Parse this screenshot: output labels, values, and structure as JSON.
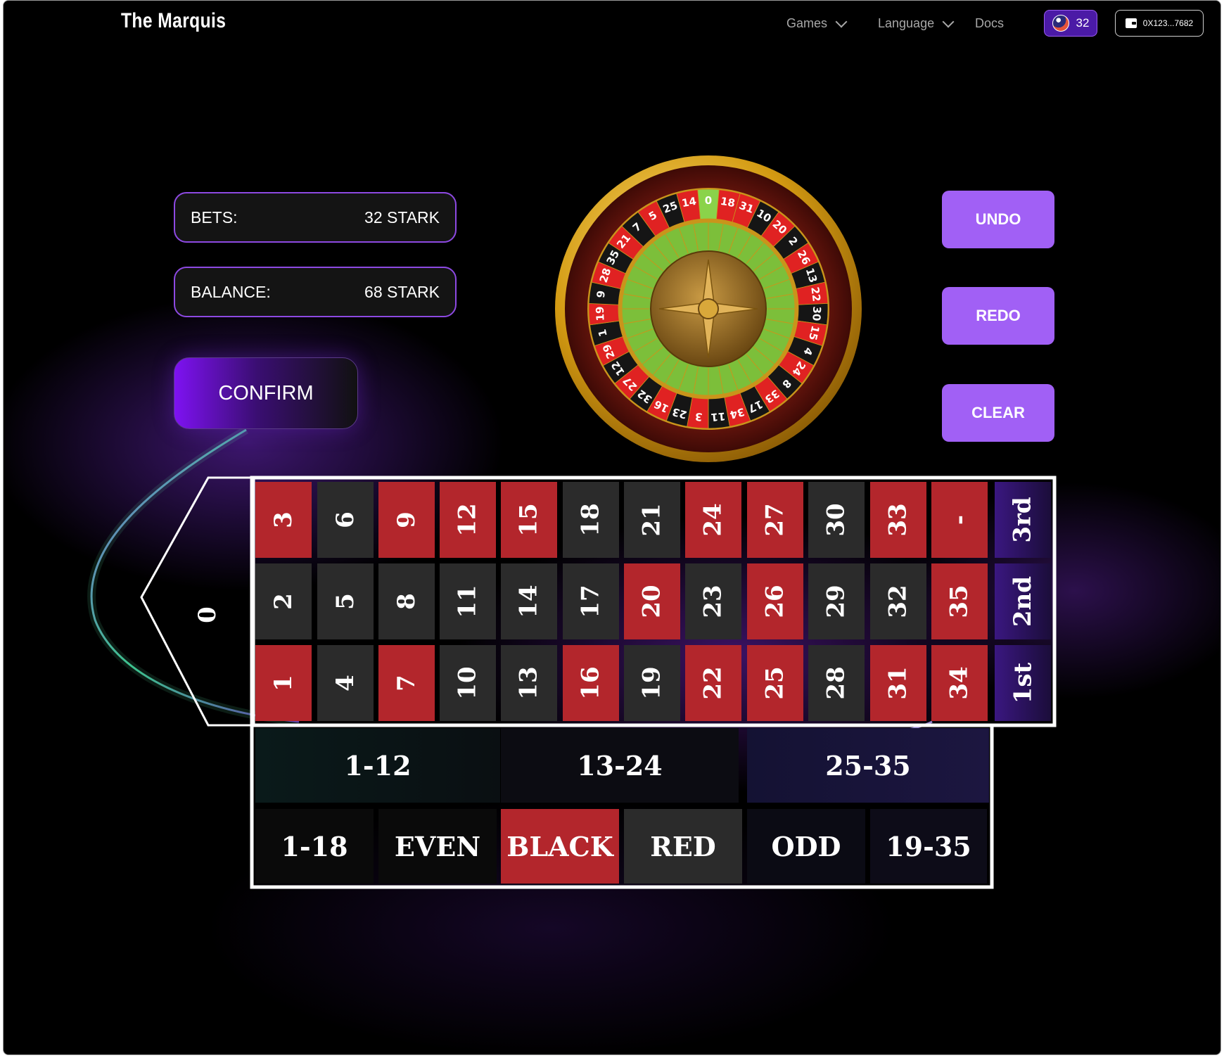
{
  "nav": {
    "logo": "The Marquis",
    "games_label": "Games",
    "language_label": "Language",
    "docs_label": "Docs",
    "token_count": "32",
    "wallet_address": "0X123...7682"
  },
  "info": {
    "bets_label": "BETS:",
    "bets_value": "32 STARK",
    "balance_label": "BALANCE:",
    "balance_value": "68 STARK"
  },
  "actions": {
    "confirm_label": "CONFIRM",
    "undo_label": "UNDO",
    "redo_label": "REDO",
    "clear_label": "CLEAR"
  },
  "wheel": {
    "numbers": [
      "0",
      "18",
      "31",
      "10",
      "20",
      "2",
      "26",
      "13",
      "22",
      "30",
      "15",
      "4",
      "24",
      "8",
      "33",
      "17",
      "34",
      "11",
      "3",
      "23",
      "16",
      "32",
      "27",
      "12",
      "29",
      "1",
      "19",
      "9",
      "28",
      "35",
      "21",
      "7",
      "5",
      "25",
      "14"
    ],
    "colors": [
      "green",
      "red",
      "red",
      "black",
      "red",
      "black",
      "red",
      "black",
      "red",
      "black",
      "red",
      "black",
      "red",
      "black",
      "red",
      "black",
      "red",
      "black",
      "red",
      "black",
      "red",
      "black",
      "red",
      "black",
      "red",
      "black",
      "red",
      "black",
      "red",
      "black",
      "red",
      "black",
      "red",
      "black",
      "red"
    ],
    "colors_hex": {
      "red": "#e02222",
      "black": "#151515",
      "green": "#8ad34a"
    }
  },
  "table": {
    "zero_label": "0",
    "row_top": [
      {
        "n": "3",
        "c": "red"
      },
      {
        "n": "6",
        "c": "black"
      },
      {
        "n": "9",
        "c": "red"
      },
      {
        "n": "12",
        "c": "red"
      },
      {
        "n": "15",
        "c": "red"
      },
      {
        "n": "18",
        "c": "black"
      },
      {
        "n": "21",
        "c": "black"
      },
      {
        "n": "24",
        "c": "red"
      },
      {
        "n": "27",
        "c": "red"
      },
      {
        "n": "30",
        "c": "black"
      },
      {
        "n": "33",
        "c": "red"
      },
      {
        "n": "-",
        "c": "red"
      }
    ],
    "row_mid": [
      {
        "n": "2",
        "c": "black"
      },
      {
        "n": "5",
        "c": "black"
      },
      {
        "n": "8",
        "c": "black"
      },
      {
        "n": "11",
        "c": "black"
      },
      {
        "n": "14",
        "c": "black"
      },
      {
        "n": "17",
        "c": "black"
      },
      {
        "n": "20",
        "c": "red"
      },
      {
        "n": "23",
        "c": "black"
      },
      {
        "n": "26",
        "c": "red"
      },
      {
        "n": "29",
        "c": "black"
      },
      {
        "n": "32",
        "c": "black"
      },
      {
        "n": "35",
        "c": "red"
      }
    ],
    "row_bot": [
      {
        "n": "1",
        "c": "red"
      },
      {
        "n": "4",
        "c": "black"
      },
      {
        "n": "7",
        "c": "red"
      },
      {
        "n": "10",
        "c": "black"
      },
      {
        "n": "13",
        "c": "black"
      },
      {
        "n": "16",
        "c": "red"
      },
      {
        "n": "19",
        "c": "black"
      },
      {
        "n": "22",
        "c": "red"
      },
      {
        "n": "25",
        "c": "red"
      },
      {
        "n": "28",
        "c": "black"
      },
      {
        "n": "31",
        "c": "red"
      },
      {
        "n": "34",
        "c": "red"
      }
    ],
    "columns": [
      "3rd",
      "2nd",
      "1st"
    ],
    "dozens": [
      "1-12",
      "13-24",
      "25-35"
    ],
    "outside": [
      "1-18",
      "EVEN",
      "BLACK",
      "RED",
      "ODD",
      "19-35"
    ]
  },
  "colors": {
    "accent_purple": "#a160f5",
    "table_red": "#b3262c",
    "table_black": "#2b2b2b"
  }
}
